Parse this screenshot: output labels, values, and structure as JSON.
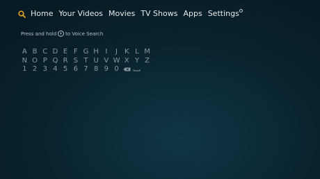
{
  "nav": {
    "search_icon": "search-icon",
    "items": [
      "Home",
      "Your Videos",
      "Movies",
      "TV Shows",
      "Apps",
      "Settings"
    ]
  },
  "hint": {
    "before": "Press and hold",
    "icon": "microphone-icon",
    "after": "to Voice Search"
  },
  "keyboard": {
    "row1": [
      "A",
      "B",
      "C",
      "D",
      "E",
      "F",
      "G",
      "H",
      "I",
      "J",
      "K",
      "L",
      "M"
    ],
    "row2": [
      "N",
      "O",
      "P",
      "Q",
      "R",
      "S",
      "T",
      "U",
      "V",
      "W",
      "X",
      "Y",
      "Z"
    ],
    "row3": [
      "1",
      "2",
      "3",
      "4",
      "5",
      "6",
      "7",
      "8",
      "9",
      "0"
    ],
    "delete_icon": "backspace-icon",
    "space_icon": "space-icon"
  },
  "colors": {
    "accent": "#e6a51e",
    "background": "#0b2430",
    "text": "#e6eaed",
    "key_text": "#8a97a0"
  }
}
